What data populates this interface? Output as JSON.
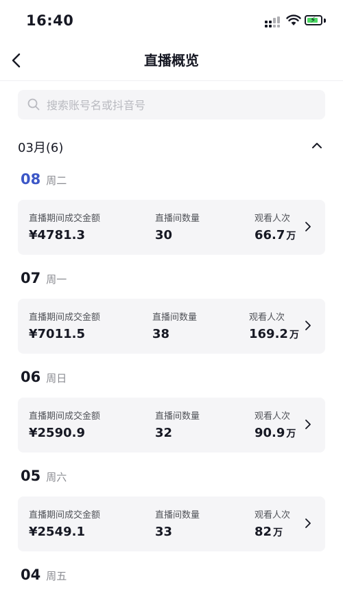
{
  "status": {
    "time": "16:40"
  },
  "nav": {
    "title": "直播概览"
  },
  "search": {
    "placeholder": "搜索账号名或抖音号",
    "value": ""
  },
  "month": {
    "label": "03月(6)"
  },
  "metric_labels": {
    "gmv": "直播期间成交金额",
    "rooms": "直播间数量",
    "views": "观看人次"
  },
  "days": [
    {
      "day": "08",
      "weekday": "周二",
      "gmv": "¥4781.3",
      "rooms": "30",
      "views": "66.7",
      "views_unit": "万"
    },
    {
      "day": "07",
      "weekday": "周一",
      "gmv": "¥7011.5",
      "rooms": "38",
      "views": "169.2",
      "views_unit": "万"
    },
    {
      "day": "06",
      "weekday": "周日",
      "gmv": "¥2590.9",
      "rooms": "32",
      "views": "90.9",
      "views_unit": "万"
    },
    {
      "day": "05",
      "weekday": "周六",
      "gmv": "¥2549.1",
      "rooms": "33",
      "views": "82",
      "views_unit": "万"
    },
    {
      "day": "04",
      "weekday": "周五"
    }
  ],
  "colors": {
    "accent": "#3c57c7",
    "card": "#f5f5f7",
    "text": "#161823",
    "secondary": "#8a8b91"
  }
}
